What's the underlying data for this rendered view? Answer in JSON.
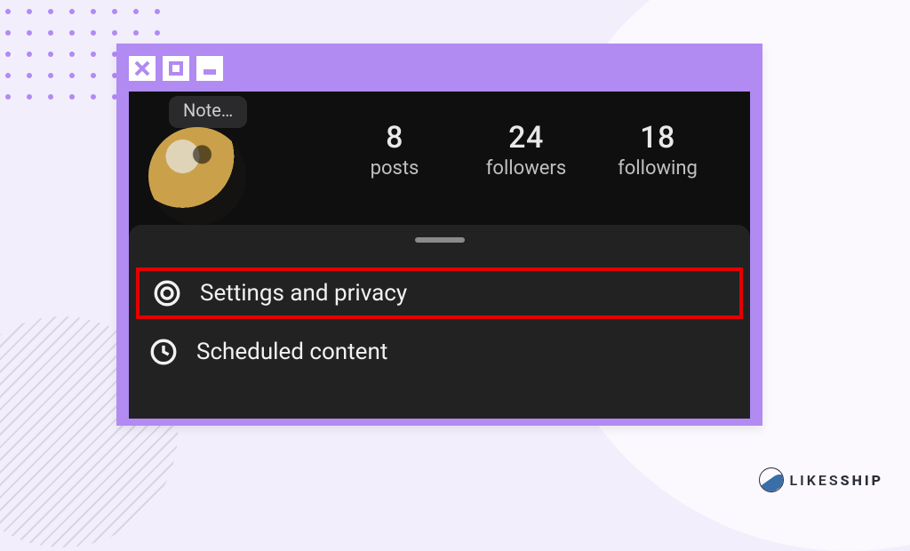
{
  "profile": {
    "note_placeholder": "Note…"
  },
  "stats": {
    "posts": {
      "count": "8",
      "label": "posts"
    },
    "followers": {
      "count": "24",
      "label": "followers"
    },
    "following": {
      "count": "18",
      "label": "following"
    }
  },
  "menu": {
    "settings_privacy": {
      "label": "Settings and privacy"
    },
    "scheduled_content": {
      "label": "Scheduled content"
    }
  },
  "brand": {
    "text_light": "LIKES",
    "text_bold": "SHIP"
  },
  "colors": {
    "frame": "#b18af2",
    "highlight": "#e40000",
    "sheet": "#222223",
    "bg_dark": "#0f0f0f"
  }
}
